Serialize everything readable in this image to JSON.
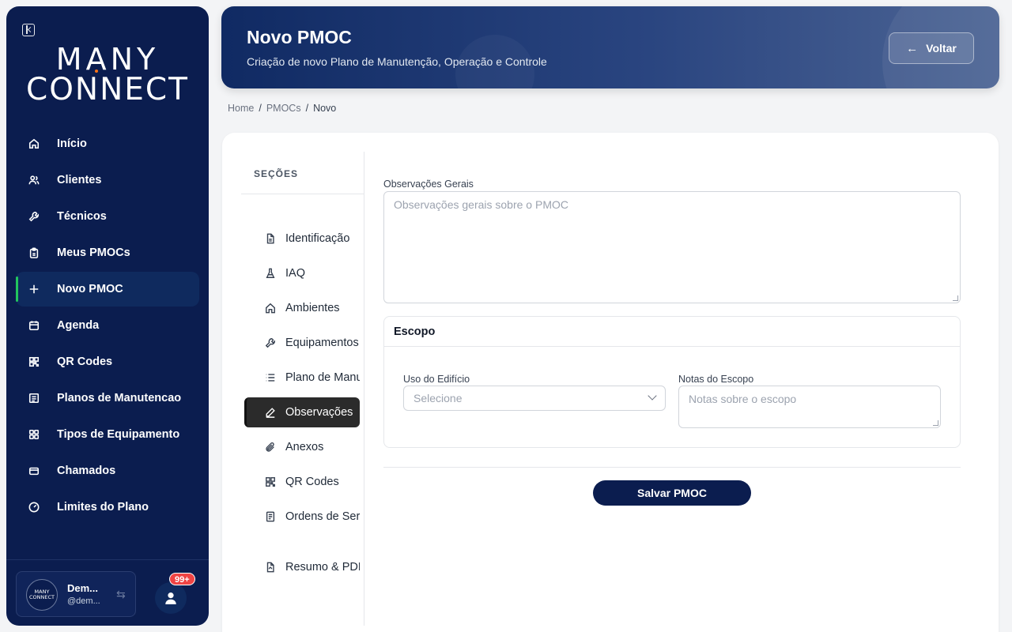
{
  "brand": {
    "line1": "MANY",
    "line2": "CONNECT"
  },
  "sidebar": {
    "items": [
      {
        "label": "Início",
        "icon": "home-icon"
      },
      {
        "label": "Clientes",
        "icon": "users-icon"
      },
      {
        "label": "Técnicos",
        "icon": "wrench-icon"
      },
      {
        "label": "Meus PMOCs",
        "icon": "clipboard-icon"
      },
      {
        "label": "Novo PMOC",
        "icon": "plus-icon",
        "active": true
      },
      {
        "label": "Agenda",
        "icon": "calendar-icon"
      },
      {
        "label": "QR Codes",
        "icon": "qrcode-icon"
      },
      {
        "label": "Planos de Manutencao",
        "icon": "list-icon"
      },
      {
        "label": "Tipos de Equipamento",
        "icon": "grid-icon"
      },
      {
        "label": "Chamados",
        "icon": "ticket-icon"
      },
      {
        "label": "Limites do Plano",
        "icon": "gauge-icon"
      }
    ],
    "user": {
      "name": "Dem...",
      "handle": "@dem...",
      "avatar_line1": "MANY",
      "avatar_line2": "CONNECT"
    },
    "notifications_badge": "99+"
  },
  "header": {
    "title": "Novo PMOC",
    "subtitle": "Criação de novo Plano de Manutenção, Operação e Controle",
    "back_label": "Voltar"
  },
  "breadcrumb": {
    "items": [
      "Home",
      "PMOCs",
      "Novo"
    ],
    "separator": "/"
  },
  "sections": {
    "title": "SEÇÕES",
    "items": [
      {
        "label": "Identificação",
        "icon": "file-icon"
      },
      {
        "label": "IAQ",
        "icon": "flask-icon"
      },
      {
        "label": "Ambientes",
        "icon": "home-icon"
      },
      {
        "label": "Equipamentos",
        "icon": "wrench-icon"
      },
      {
        "label": "Plano de Manutenção",
        "icon": "list-icon"
      },
      {
        "label": "Observações",
        "icon": "pen-icon",
        "active": true
      },
      {
        "label": "Anexos",
        "icon": "paperclip-icon"
      },
      {
        "label": "QR Codes",
        "icon": "qrcode-icon"
      },
      {
        "label": "Ordens de Serviço",
        "icon": "document-icon"
      },
      {
        "label": "Resumo & PDF",
        "icon": "pdf-icon"
      }
    ]
  },
  "form": {
    "obs_label": "Observações Gerais",
    "obs_placeholder": "Observações gerais sobre o PMOC",
    "escopo_title": "Escopo",
    "uso_label": "Uso do Edifício",
    "uso_placeholder": "Selecione",
    "notas_label": "Notas do Escopo",
    "notas_placeholder": "Notas sobre o escopo",
    "save_label": "Salvar PMOC"
  },
  "colors": {
    "navy": "#0b1d4f",
    "accent_active": "#22c55e",
    "badge": "#ef4444"
  }
}
